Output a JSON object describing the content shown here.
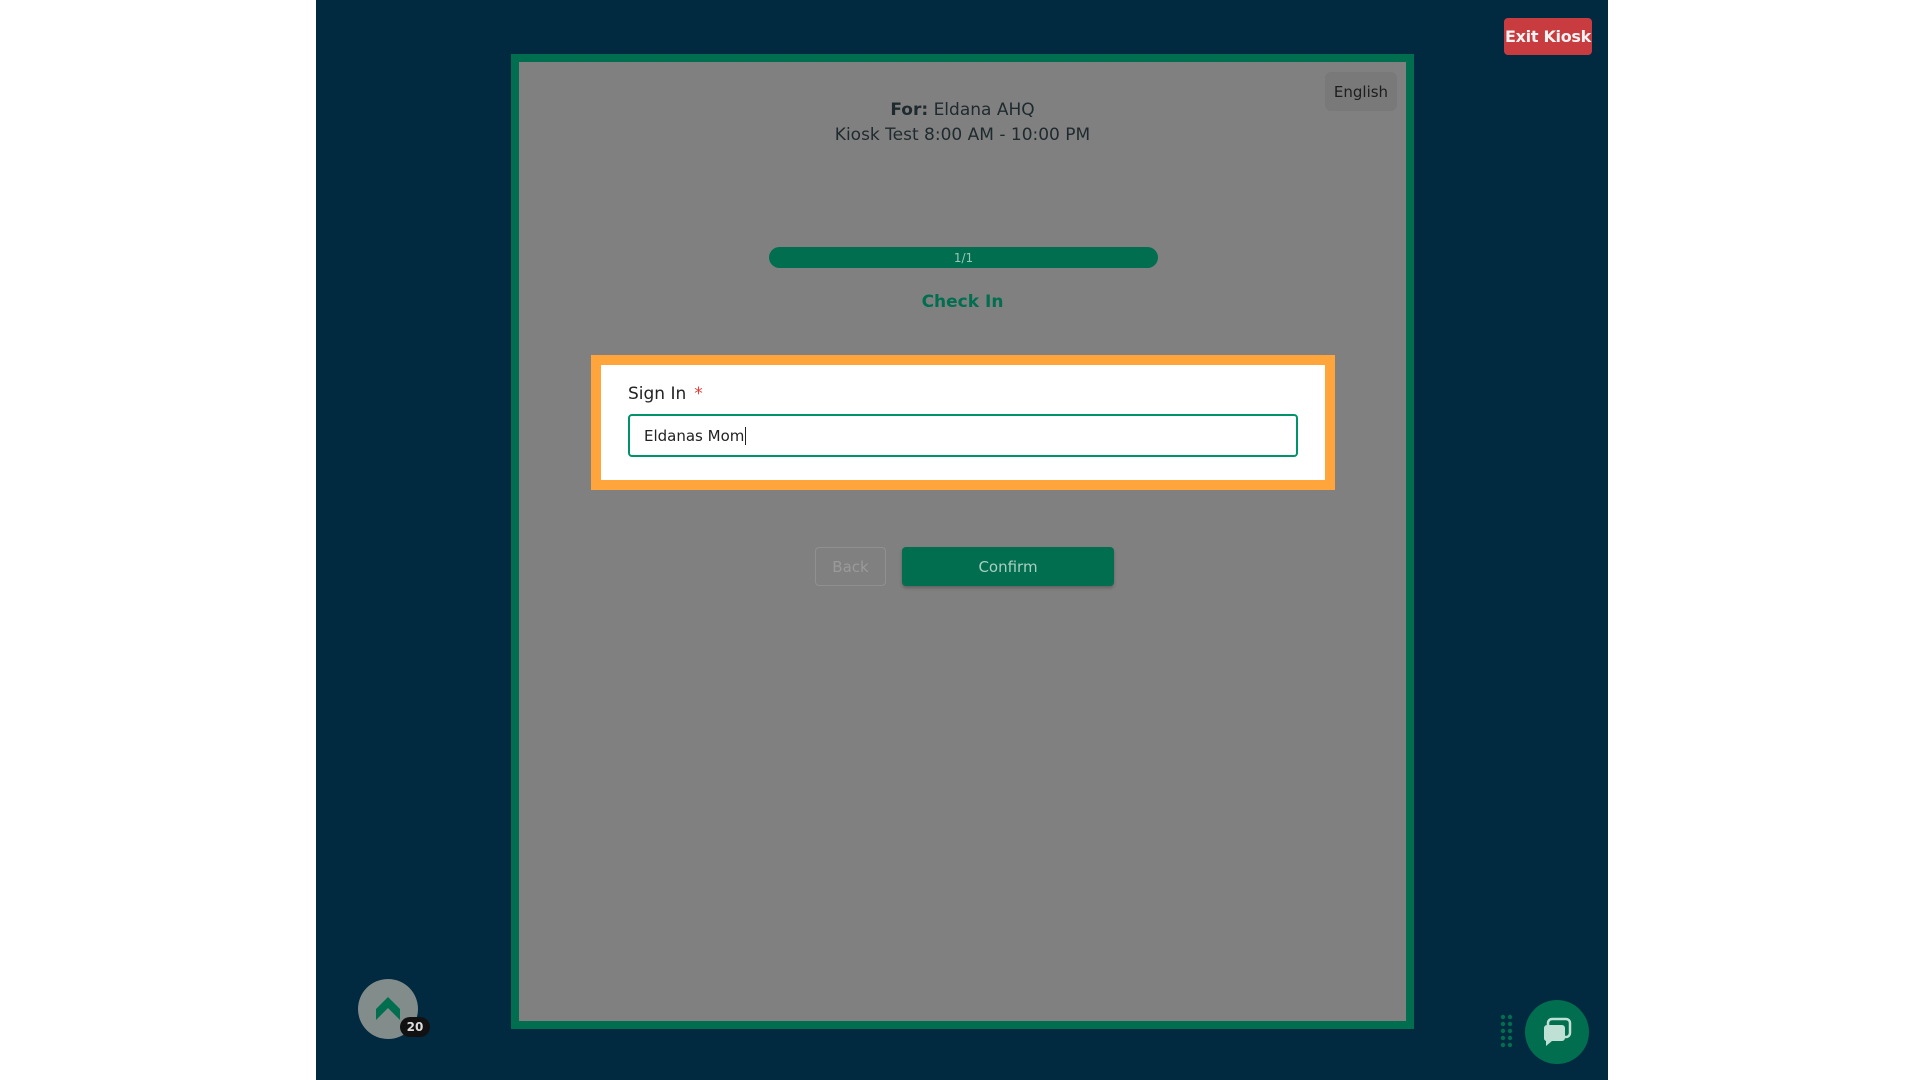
{
  "header": {
    "exit_label": "Exit Kiosk"
  },
  "kiosk": {
    "language": "English",
    "for_label": "For:",
    "for_value": "Eldana AHQ",
    "schedule": "Kiosk Test 8:00 AM - 10:00 PM",
    "progress_text": "1/1",
    "progress_fraction": 1.0,
    "step_title": "Check In",
    "form": {
      "field_label": "Sign In",
      "required_mark": "*",
      "field_value": "Eldanas Mom"
    },
    "buttons": {
      "back": "Back",
      "confirm": "Confirm"
    }
  },
  "widgets": {
    "badge_count": "20",
    "badge_icon": "chevron-up-icon",
    "chat_icon": "chat-bubble-icon",
    "drag_icon": "drag-handle-icon"
  },
  "colors": {
    "background": "#012a40",
    "brand_green": "#006e4f",
    "exit_red": "#c83c3f",
    "highlight_orange": "#ffa53c",
    "overlay_gray": "#808080"
  }
}
